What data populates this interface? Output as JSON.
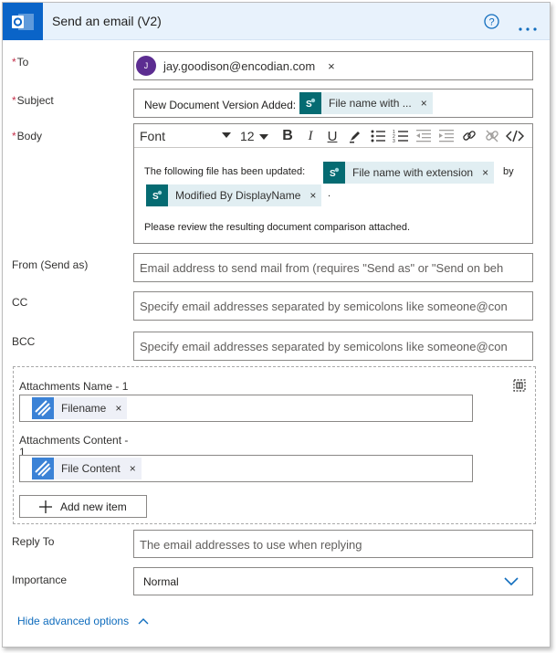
{
  "header": {
    "title": "Send an email (V2)",
    "app_icon": "outlook-icon",
    "help_icon": "help-circle-icon",
    "more_icon": "more-horizontal-icon"
  },
  "colors": {
    "brand": "#0a64c8",
    "required": "#c4314b",
    "link": "#0f6cbd",
    "sharepoint": "#056b72"
  },
  "to": {
    "label": "To",
    "required_mark": "*",
    "avatar_initial": "J",
    "recipient": "jay.goodison@encodian.com",
    "remove": "×"
  },
  "subject": {
    "label": "Subject",
    "required_mark": "*",
    "prefix": "New Document Version Added:",
    "token": "File name with ...",
    "remove": "×"
  },
  "body": {
    "label": "Body",
    "required_mark": "*",
    "toolbar": {
      "font": "Font",
      "size": "12",
      "bold": "B",
      "italic": "I",
      "underline": "U"
    },
    "line1": "The following file has been updated:",
    "token1": "File name with extension",
    "by": "by",
    "token2": "Modified By DisplayName",
    "period": ".",
    "line3": "Please review the resulting document comparison attached.",
    "remove": "×"
  },
  "from": {
    "label": "From (Send as)",
    "placeholder": "Email address to send mail from (requires \"Send as\" or \"Send on beh"
  },
  "cc": {
    "label": "CC",
    "placeholder": "Specify email addresses separated by semicolons like someone@con"
  },
  "bcc": {
    "label": "BCC",
    "placeholder": "Specify email addresses separated by semicolons like someone@con"
  },
  "attachments": {
    "name_label": "Attachments Name - 1",
    "name_token": "Filename",
    "content_label_1": "Attachments Content -",
    "content_label_2": "1",
    "content_token": "File Content",
    "add_item": "Add new item",
    "remove": "×"
  },
  "reply_to": {
    "label": "Reply To",
    "placeholder": "The email addresses to use when replying"
  },
  "importance": {
    "label": "Importance",
    "value": "Normal"
  },
  "advanced": {
    "label": "Hide advanced options"
  }
}
